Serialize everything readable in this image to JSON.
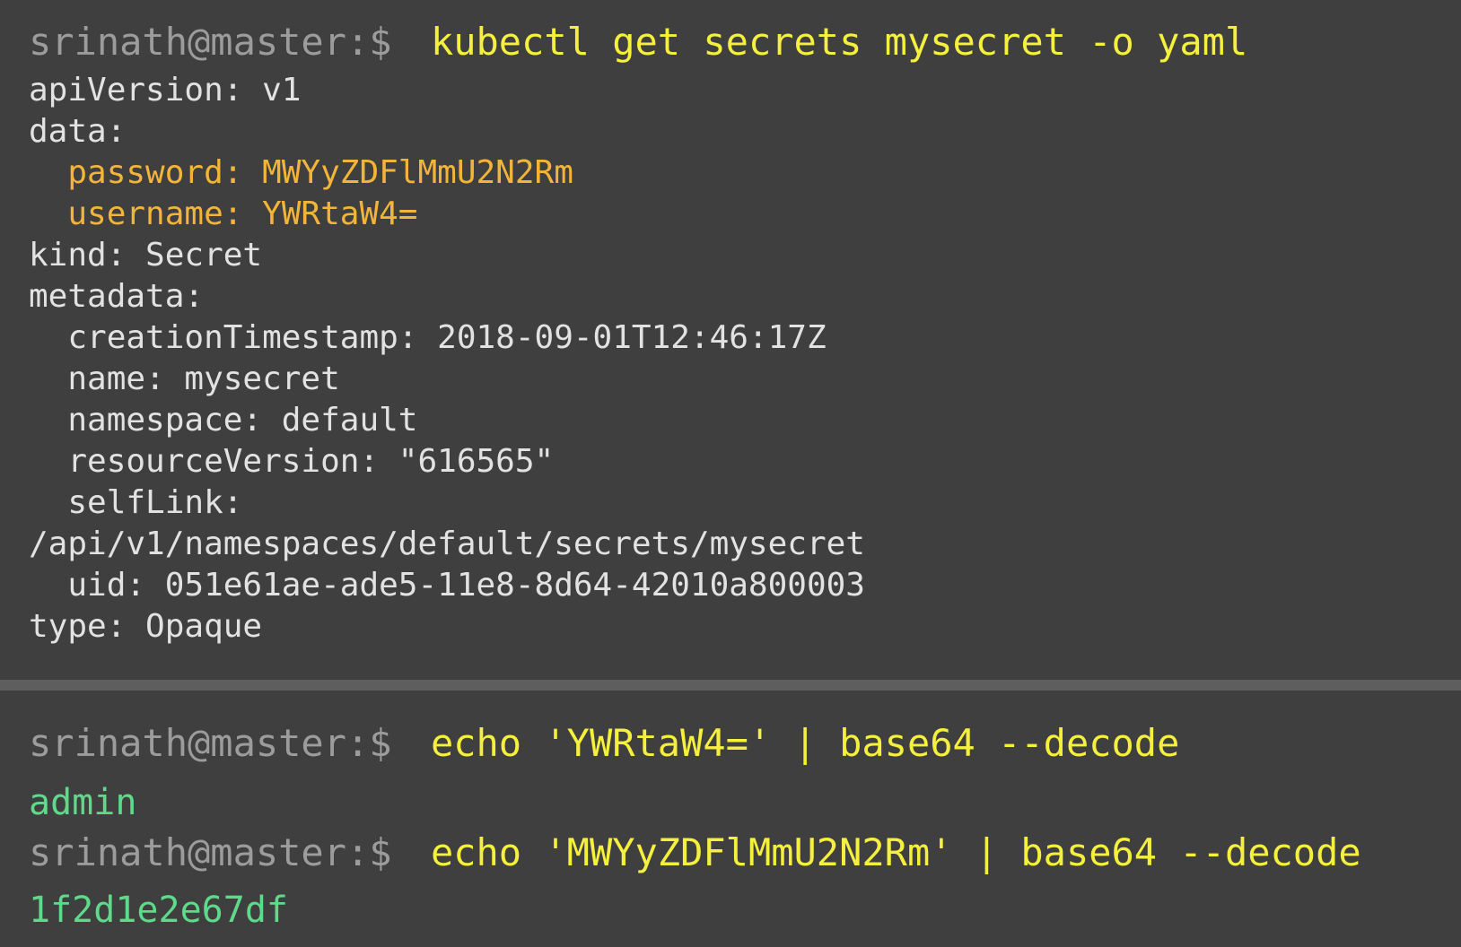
{
  "terminal_top": {
    "prompt": "srinath@master:$",
    "command": "kubectl get secrets mysecret -o yaml",
    "output_lines": [
      {
        "text": "apiVersion: v1",
        "kind": "plain"
      },
      {
        "text": "data:",
        "kind": "plain"
      },
      {
        "text": "  password: MWYyZDFlMmU2N2Rm",
        "kind": "highlight"
      },
      {
        "text": "  username: YWRtaW4=",
        "kind": "highlight"
      },
      {
        "text": "kind: Secret",
        "kind": "plain"
      },
      {
        "text": "metadata:",
        "kind": "plain"
      },
      {
        "text": "  creationTimestamp: 2018-09-01T12:46:17Z",
        "kind": "plain"
      },
      {
        "text": "  name: mysecret",
        "kind": "plain"
      },
      {
        "text": "  namespace: default",
        "kind": "plain"
      },
      {
        "text": "  resourceVersion: \"616565\"",
        "kind": "plain"
      },
      {
        "text": "  selfLink:",
        "kind": "plain"
      },
      {
        "text": "/api/v1/namespaces/default/secrets/mysecret",
        "kind": "plain"
      },
      {
        "text": "  uid: 051e61ae-ade5-11e8-8d64-42010a800003",
        "kind": "plain"
      },
      {
        "text": "type: Opaque",
        "kind": "plain"
      }
    ]
  },
  "terminal_bottom": {
    "entries": [
      {
        "prompt": "srinath@master:$",
        "command": "echo 'YWRtaW4=' | base64 --decode",
        "output": "admin"
      },
      {
        "prompt": "srinath@master:$",
        "command": "echo 'MWYyZDFlMmU2N2Rm' | base64 --decode",
        "output": "1f2d1e2e67df"
      }
    ]
  },
  "colors": {
    "background": "#3f3f3f",
    "divider": "#5e5e5e",
    "prompt": "#9c9c9c",
    "command": "#f5ef3d",
    "plain_output": "#e2e2e2",
    "highlight_output": "#f3b43a",
    "decoded_output": "#5fd98a"
  }
}
